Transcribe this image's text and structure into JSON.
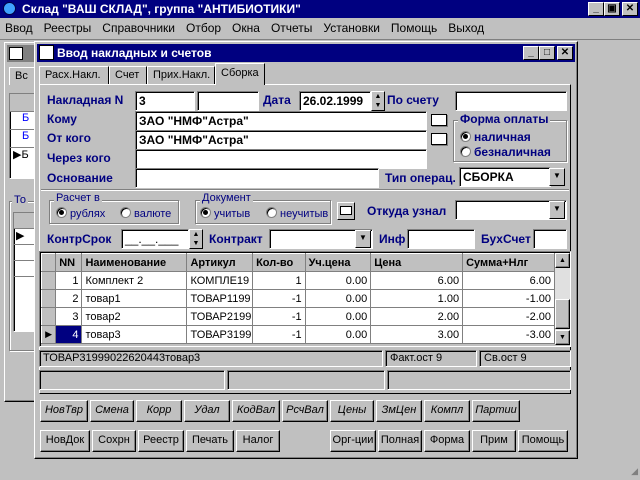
{
  "app": {
    "title": "Склад \"ВАШ СКЛАД\", группа \"АНТИБИОТИКИ\"",
    "menu": [
      "Ввод",
      "Реестры",
      "Справочники",
      "Отбор",
      "Окна",
      "Отчеты",
      "Установки",
      "Помощь",
      "Выход"
    ]
  },
  "background_window": {
    "tab_label": "Вс",
    "group_label": "То"
  },
  "dialog": {
    "title": "Ввод накладных и счетов",
    "tabs": [
      "Расх.Накл.",
      "Счет",
      "Прих.Накл.",
      "Сборка"
    ],
    "active_tab": "Сборка"
  },
  "form": {
    "invoice_label": "Накладная N",
    "invoice_number": "3",
    "invoice_extra": "",
    "date_label": "Дата",
    "date_value": "26.02.1999",
    "by_account_label": "По счету",
    "by_account_value": "",
    "to_label": "Кому",
    "to_value": "ЗАО \"НМФ\"Астра\"",
    "from_label": "От кого",
    "from_value": "ЗАО \"НМФ\"Астра\"",
    "via_label": "Через кого",
    "via_value": "",
    "basis_label": "Основание",
    "basis_value": "",
    "payment_group_label": "Форма оплаты",
    "payment_cash": "наличная",
    "payment_noncash": "безналичная",
    "payment_selected": "наличная",
    "optype_label": "Тип операц.",
    "optype_value": "СБОРКА",
    "calc_group_label": "Расчет в",
    "calc_rub": "рублях",
    "calc_cur": "валюте",
    "doc_group_label": "Документ",
    "doc_consider": "учитыв",
    "doc_not_consider": "неучитыв",
    "source_label": "Откуда узнал",
    "source_value": "",
    "control_term_label": "КонтрСрок",
    "control_term_value": "__.__.___",
    "contract_label": "Контракт",
    "contract_value": "",
    "inf_label": "Инф",
    "inf_value": "",
    "bookacc_label": "БухСчет",
    "bookacc_value": ""
  },
  "table": {
    "columns": [
      "NN",
      "Наименование",
      "Артикул",
      "Кол-во",
      "Уч.цена",
      "Цена",
      "Сумма+Нлг"
    ],
    "rows": [
      {
        "nn": "1",
        "name": "Комплект 2",
        "article": "КОМПЛЕ19",
        "qty": "1",
        "acc_price": "0.00",
        "price": "6.00",
        "sum": "6.00"
      },
      {
        "nn": "2",
        "name": "товар1",
        "article": "ТОВАР1199",
        "qty": "-1",
        "acc_price": "0.00",
        "price": "1.00",
        "sum": "-1.00"
      },
      {
        "nn": "3",
        "name": "товар2",
        "article": "ТОВАР2199",
        "qty": "-1",
        "acc_price": "0.00",
        "price": "2.00",
        "sum": "-2.00"
      },
      {
        "nn": "4",
        "name": "товар3",
        "article": "ТОВАР3199",
        "qty": "-1",
        "acc_price": "0.00",
        "price": "3.00",
        "sum": "-3.00"
      }
    ],
    "selected_row": 4
  },
  "status": {
    "item_code": "ТОВАР31999022620443товар3",
    "fact_stock": "Факт.ост 9",
    "free_stock": "Св.ост 9"
  },
  "toolbar_italic": [
    "НовТвр",
    "Смена",
    "Корр",
    "Удал",
    "КодВал",
    "РсчВал",
    "Цены",
    "ЗмЦен",
    "Компл",
    "Партии"
  ],
  "toolbar_bottom_left": [
    "НовДок",
    "Сохрн",
    "Реестр",
    "Печать",
    "Налог"
  ],
  "toolbar_bottom_right": [
    "Орг-ции",
    "Полная",
    "Форма",
    "Прим",
    "Помощь"
  ]
}
